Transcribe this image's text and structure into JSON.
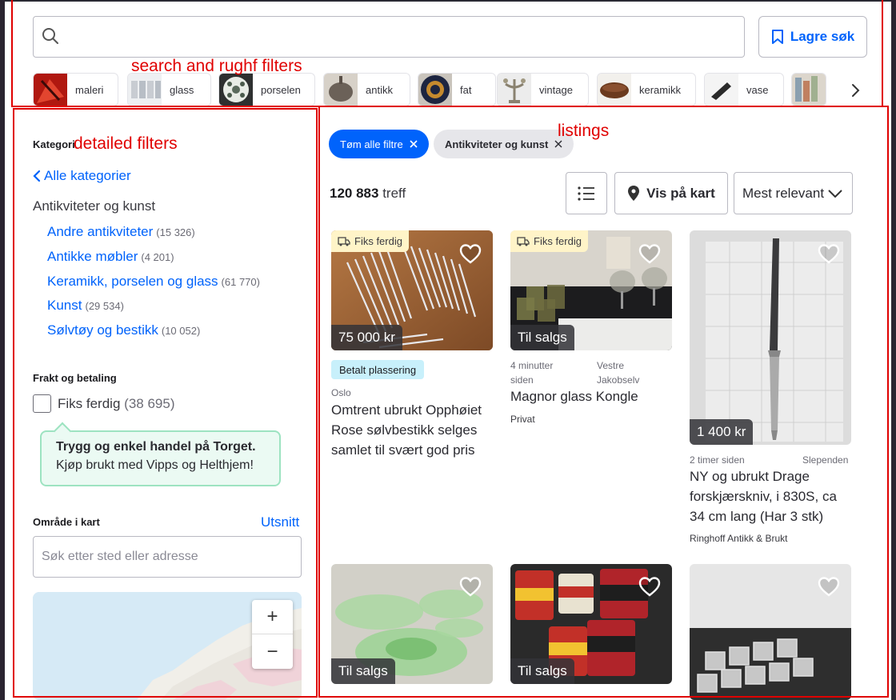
{
  "annotations": {
    "search": "search and rughf filters",
    "filters": "detailed filters",
    "listings": "listings"
  },
  "search": {
    "placeholder": "",
    "save_label": "Lagre søk"
  },
  "chips": [
    {
      "label": "maleri"
    },
    {
      "label": "glass"
    },
    {
      "label": "porselen"
    },
    {
      "label": "antikk"
    },
    {
      "label": "fat"
    },
    {
      "label": "vintage"
    },
    {
      "label": "keramikk"
    },
    {
      "label": "vase"
    }
  ],
  "sidebar": {
    "category_heading": "Kategori",
    "back_label": "Alle kategorier",
    "current_category": "Antikviteter og kunst",
    "subcategories": [
      {
        "label": "Andre antikviteter",
        "count": "(15 326)"
      },
      {
        "label": "Antikke møbler",
        "count": "(4 201)"
      },
      {
        "label": "Keramikk, porselen og glass",
        "count": "(61 770)"
      },
      {
        "label": "Kunst",
        "count": "(29 534)"
      },
      {
        "label": "Sølvtøy og bestikk",
        "count": "(10 052)"
      }
    ],
    "shipping_heading": "Frakt og betaling",
    "fiks_label": "Fiks ferdig",
    "fiks_count": "(38 695)",
    "promo_title": "Trygg og enkel handel på Torget.",
    "promo_text": "Kjøp brukt med Vipps og Helthjem!",
    "area_heading": "Område i kart",
    "area_link": "Utsnitt",
    "area_placeholder": "Søk etter sted eller adresse",
    "zoom_in": "+",
    "zoom_out": "−"
  },
  "results": {
    "clear_filters": "Tøm alle filtre",
    "active_filter": "Antikviteter og kunst",
    "hits_number": "120 883",
    "hits_label": "treff",
    "map_label": "Vis på kart",
    "sort_label": "Mest relevant"
  },
  "listings": [
    {
      "badge": "Fiks ferdig",
      "price": "75 000 kr",
      "paid": "Betalt plassering",
      "location": "Oslo",
      "title_lines": [
        "Omtrent ubrukt Opphøiet",
        "Rose sølvbestikk selges",
        "samlet til svært god pris"
      ]
    },
    {
      "badge": "Fiks ferdig",
      "price": "Til salgs",
      "time": "4 minutter siden",
      "location": "Vestre Jakobselv",
      "title": "Magnor glass Kongle",
      "seller": "Privat"
    },
    {
      "price": "1 400 kr",
      "time": "2 timer siden",
      "location": "Slependen",
      "title_lines": [
        "NY og ubrukt Drage",
        "forskjærskniv, i 830S, ca",
        "34 cm lang (Har 3 stk)"
      ],
      "seller": "Ringhoff Antikk & Brukt"
    },
    {
      "price": "Til salgs"
    },
    {
      "price": "Til salgs"
    },
    {}
  ],
  "colors": {
    "accent": "#0063fb",
    "annotation_red": "#e00000",
    "promo_bg": "#ebfaf3",
    "paid_bg": "#c8f0fb",
    "fiks_bg": "#fff4c8"
  }
}
